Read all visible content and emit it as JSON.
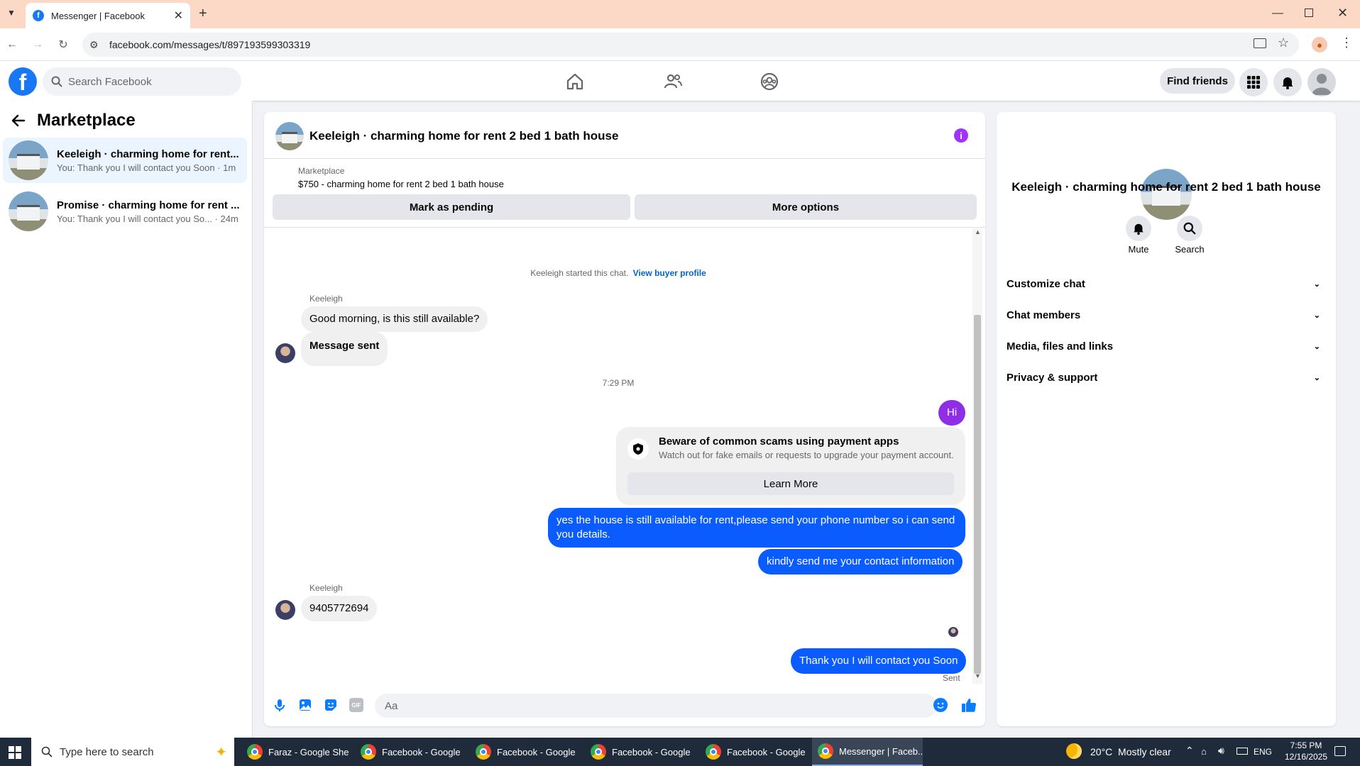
{
  "browser": {
    "tab_title": "Messenger | Facebook",
    "url": "facebook.com/messages/t/897193599303319"
  },
  "header": {
    "search_placeholder": "Search Facebook",
    "find_friends": "Find friends"
  },
  "sidebar": {
    "title": "Marketplace",
    "conversations": [
      {
        "title": "Keeleigh · charming home for rent...",
        "preview": "You: Thank you I will contact you Soon · 1m"
      },
      {
        "title": "Promise · charming home for rent ...",
        "preview": "You: Thank you I will contact you So... · 24m"
      }
    ]
  },
  "chat": {
    "title": "Keeleigh · charming home for rent 2 bed 1 bath house",
    "listing_source": "Marketplace",
    "listing_price_title": "$750 - charming home for rent 2 bed 1 bath house",
    "mark_pending": "Mark as pending",
    "more_options": "More options",
    "started_text": "Keeleigh started this chat.",
    "view_profile": "View buyer profile",
    "sender_name": "Keeleigh",
    "msg1": "Good morning, is this still available?",
    "msg2": "Message sent",
    "time_divider": "7:29 PM",
    "out1": "Hi",
    "scam_title": "Beware of common scams using payment apps",
    "scam_body": "Watch out for fake emails or requests to upgrade your payment account.",
    "learn_more": "Learn More",
    "out2": "yes the house is still available for rent,please send your phone number so i can send you details.",
    "out3": "kindly send me your contact information",
    "sender_name2": "Keeleigh",
    "msg3": "9405772694",
    "out4": "Thank you I will contact you Soon",
    "status": "Sent",
    "composer_placeholder": "Aa"
  },
  "details": {
    "title": "Keeleigh · charming home for rent 2 bed 1 bath house",
    "mute": "Mute",
    "search": "Search",
    "sections": [
      "Customize chat",
      "Chat members",
      "Media, files and links",
      "Privacy & support"
    ]
  },
  "taskbar": {
    "search_placeholder": "Type here to search",
    "apps": [
      "Faraz - Google She...",
      "Facebook - Google ...",
      "Facebook - Google ...",
      "Facebook - Google ...",
      "Facebook - Google ...",
      "Messenger | Faceb..."
    ],
    "weather": "20°C  Mostly clear",
    "lang": "ENG",
    "time": "7:55 PM",
    "date": "12/16/2025"
  },
  "colors": {
    "fb_blue": "#1877f2",
    "messenger_blue": "#0a5cff",
    "purple_accent": "#a033ff"
  }
}
